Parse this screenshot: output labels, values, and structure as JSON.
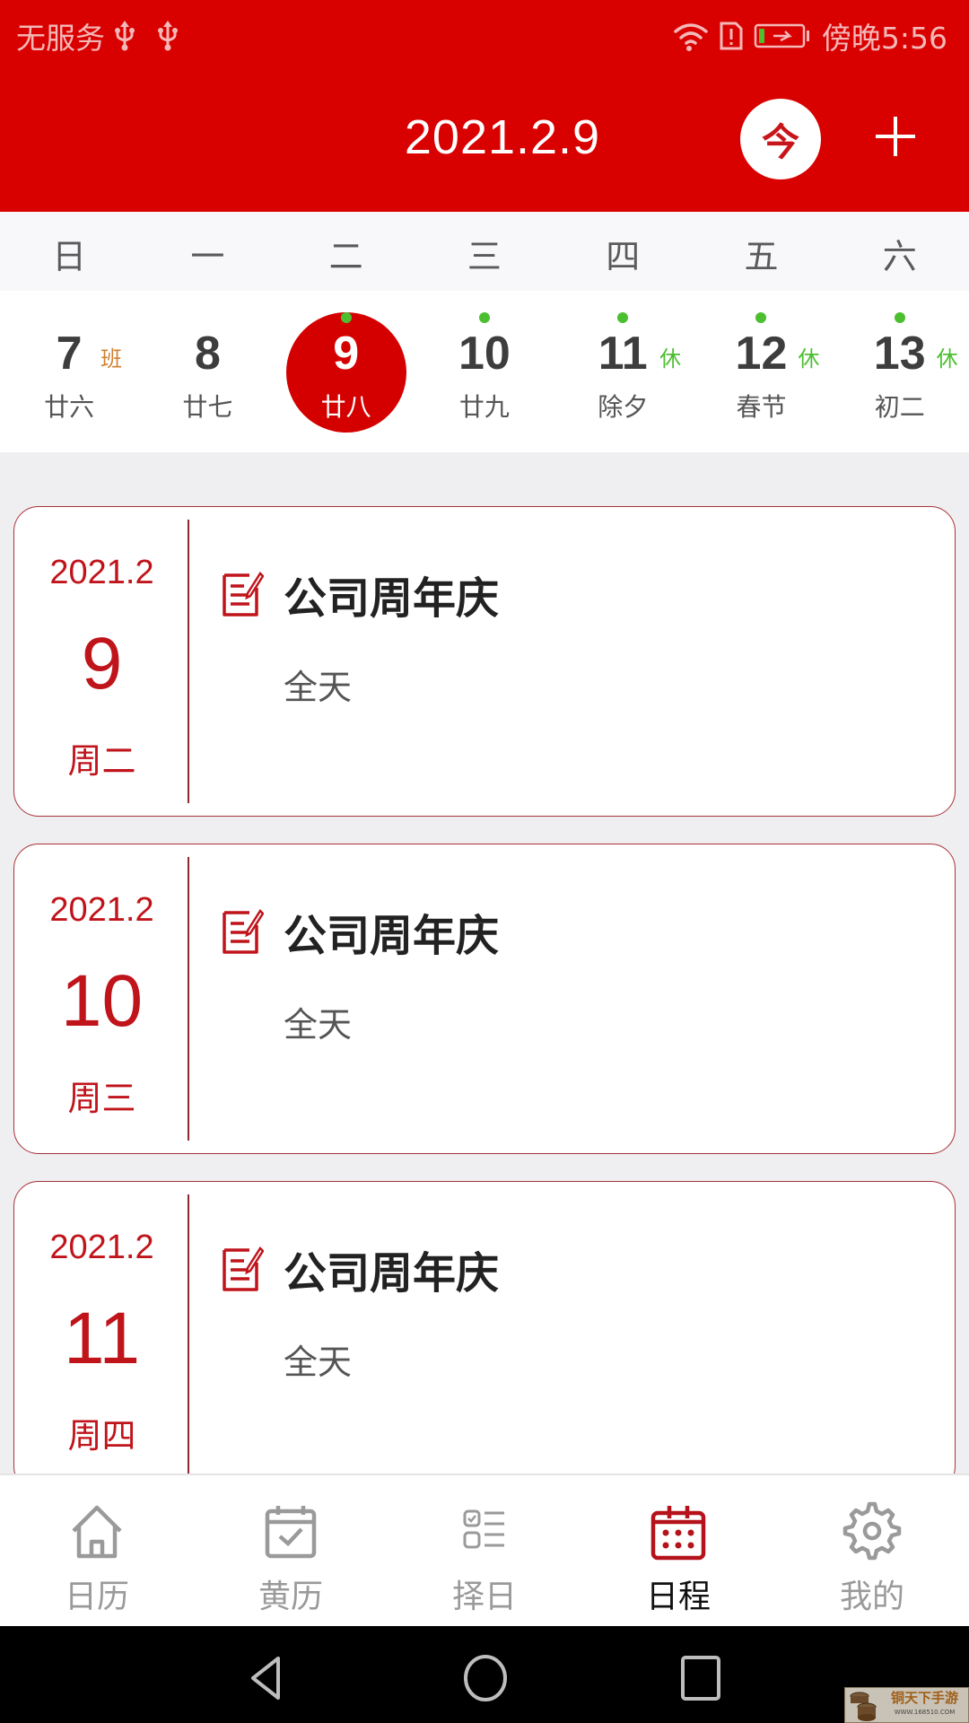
{
  "status_bar": {
    "carrier": "无服务",
    "time": "傍晚5:56",
    "icons": [
      "usb-icon",
      "usb-icon",
      "wifi-icon",
      "sim-alert-icon",
      "battery-charging-icon"
    ]
  },
  "header": {
    "title": "2021.2.9",
    "today_button": "今",
    "add_button_icon": "plus-icon"
  },
  "colors": {
    "brand_red": "#d90000",
    "accent_red": "#c0141b",
    "holiday_green": "#4cbf30",
    "workday_orange": "#d08030"
  },
  "week": {
    "weekdays": [
      "日",
      "一",
      "二",
      "三",
      "四",
      "五",
      "六"
    ],
    "days": [
      {
        "num": "7",
        "lunar": "廿六",
        "tag": "班",
        "tag_type": "work",
        "has_event": false,
        "selected": false
      },
      {
        "num": "8",
        "lunar": "廿七",
        "tag": "",
        "tag_type": "",
        "has_event": false,
        "selected": false
      },
      {
        "num": "9",
        "lunar": "廿八",
        "tag": "",
        "tag_type": "",
        "has_event": true,
        "selected": true
      },
      {
        "num": "10",
        "lunar": "廿九",
        "tag": "",
        "tag_type": "",
        "has_event": true,
        "selected": false
      },
      {
        "num": "11",
        "lunar": "除夕",
        "tag": "休",
        "tag_type": "holiday",
        "has_event": true,
        "selected": false
      },
      {
        "num": "12",
        "lunar": "春节",
        "tag": "休",
        "tag_type": "holiday",
        "has_event": true,
        "selected": false
      },
      {
        "num": "13",
        "lunar": "初二",
        "tag": "休",
        "tag_type": "holiday",
        "has_event": true,
        "selected": false
      }
    ]
  },
  "events": [
    {
      "year_month": "2021.2",
      "day": "9",
      "weekday": "周二",
      "title": "公司周年庆",
      "time": "全天"
    },
    {
      "year_month": "2021.2",
      "day": "10",
      "weekday": "周三",
      "title": "公司周年庆",
      "time": "全天"
    },
    {
      "year_month": "2021.2",
      "day": "11",
      "weekday": "周四",
      "title": "公司周年庆",
      "time": "全天"
    }
  ],
  "bottom_nav": [
    {
      "label": "日历",
      "icon": "home-icon",
      "active": false
    },
    {
      "label": "黄历",
      "icon": "calendar-check-icon",
      "active": false
    },
    {
      "label": "择日",
      "icon": "checklist-icon",
      "active": false
    },
    {
      "label": "日程",
      "icon": "schedule-calendar-icon",
      "active": true
    },
    {
      "label": "我的",
      "icon": "gear-icon",
      "active": false
    }
  ],
  "system_nav": [
    "back-icon",
    "home-circle-icon",
    "recents-icon"
  ],
  "watermark": {
    "name": "铜天下手游",
    "url": "WWW.168510.COM"
  }
}
